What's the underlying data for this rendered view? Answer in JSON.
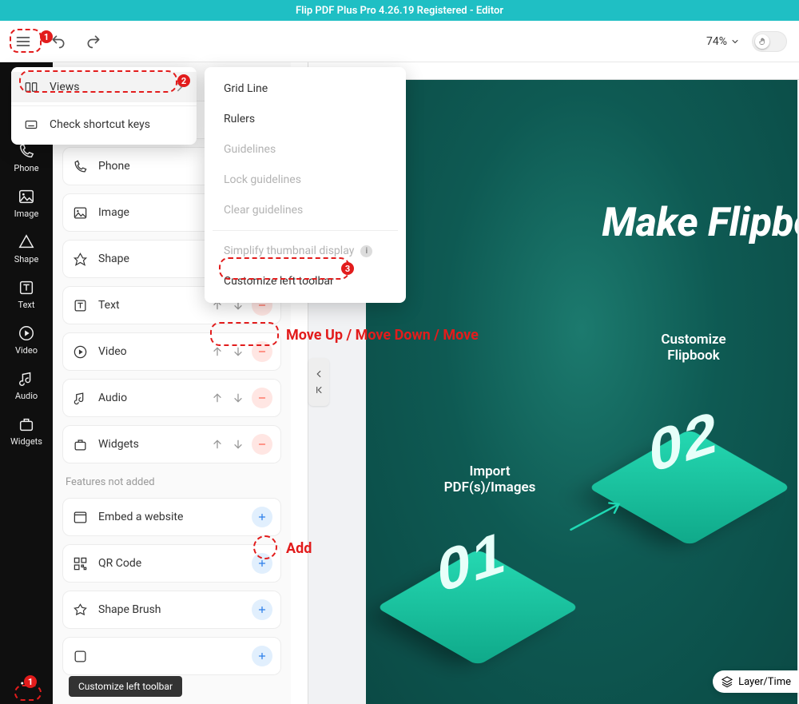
{
  "titlebar": {
    "title": "Flip PDF Plus Pro 4.26.19 Registered - Editor"
  },
  "toolbar": {
    "zoom_label": "74%"
  },
  "sidebar": {
    "items": [
      {
        "key": "phone",
        "label": "Phone"
      },
      {
        "key": "image",
        "label": "Image"
      },
      {
        "key": "shape",
        "label": "Shape"
      },
      {
        "key": "text",
        "label": "Text"
      },
      {
        "key": "video",
        "label": "Video"
      },
      {
        "key": "audio",
        "label": "Audio"
      },
      {
        "key": "widgets",
        "label": "Widgets"
      }
    ],
    "more_tooltip": "Customize left toolbar"
  },
  "dropdown1": {
    "views": "Views",
    "shortcut": "Check shortcut keys"
  },
  "dropdown2": {
    "grid": "Grid Line",
    "rulers": "Rulers",
    "guidelines": "Guidelines",
    "lock_guidelines": "Lock guidelines",
    "clear_guidelines": "Clear guidelines",
    "simplify": "Simplify thumbnail display",
    "customize": "Customize left toolbar"
  },
  "panel": {
    "items_added": [
      {
        "label": "Phone"
      },
      {
        "label": "Image"
      },
      {
        "label": "Shape"
      },
      {
        "label": "Text"
      },
      {
        "label": "Video"
      },
      {
        "label": "Audio"
      },
      {
        "label": "Widgets"
      }
    ],
    "not_added_header": "Features not added",
    "items_not_added": [
      {
        "label": "Embed a website"
      },
      {
        "label": "QR Code"
      },
      {
        "label": "Shape Brush"
      }
    ]
  },
  "canvas": {
    "hero": "Make Flipboo",
    "tile01_label_line1": "Import",
    "tile01_label_line2": "PDF(s)/Images",
    "tile01_num": "01",
    "tile02_label_line1": "Customize",
    "tile02_label_line2": "Flipbook",
    "tile02_num": "02",
    "layer_button": "Layer/Time"
  },
  "annotations": {
    "move_label": "Move Up / Move Down / Move",
    "add_label": "Add",
    "b1": "1",
    "b2": "2",
    "b3": "3",
    "bbl": "1"
  }
}
